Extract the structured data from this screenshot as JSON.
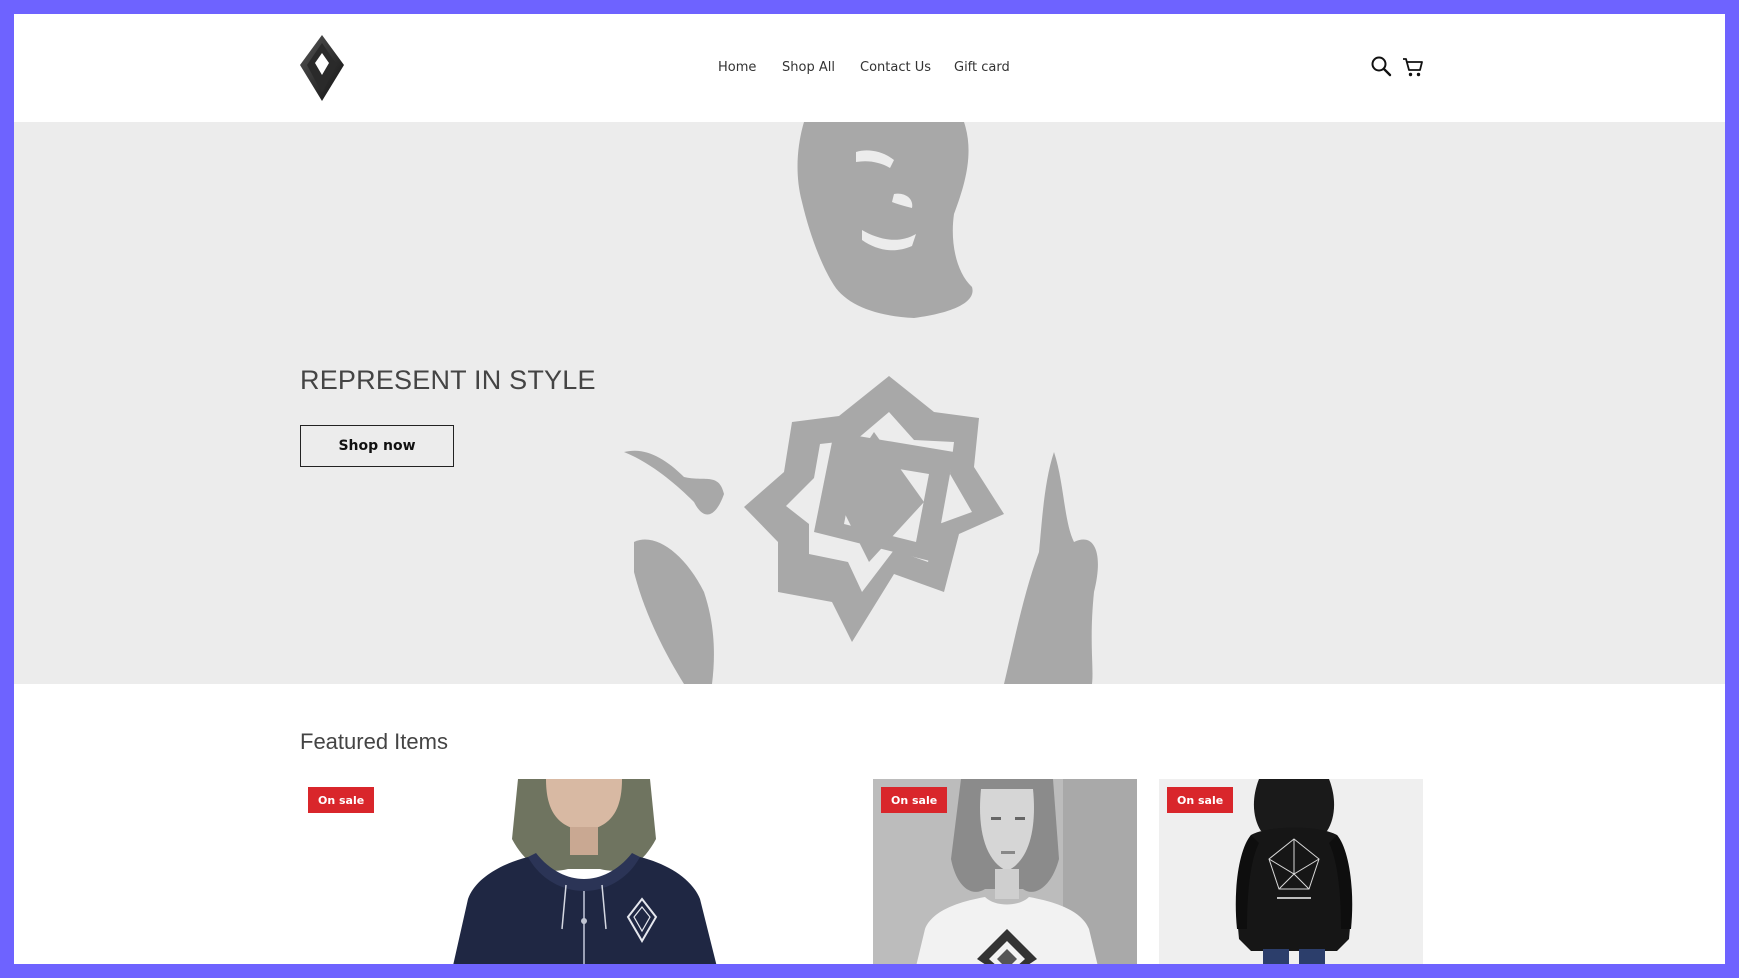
{
  "header": {
    "logo": "diamond-logo",
    "nav": [
      {
        "label": "Home"
      },
      {
        "label": "Shop All"
      },
      {
        "label": "Contact Us"
      },
      {
        "label": "Gift card"
      }
    ],
    "icons": [
      "search-icon",
      "cart-icon"
    ]
  },
  "hero": {
    "title": "REPRESENT IN STYLE",
    "button_label": "Shop now",
    "background_color": "#ececec",
    "art_color": "#a8a8a8"
  },
  "featured": {
    "title": "Featured Items",
    "items": [
      {
        "badge": "On sale",
        "image": "navy-zip-hoodie-photo"
      },
      {
        "badge": "On sale",
        "image": "woman-white-tshirt-photo"
      },
      {
        "badge": "On sale",
        "image": "black-hoodie-back-photo"
      }
    ]
  },
  "colors": {
    "frame": "#6e63ff",
    "badge": "#d9262b"
  }
}
